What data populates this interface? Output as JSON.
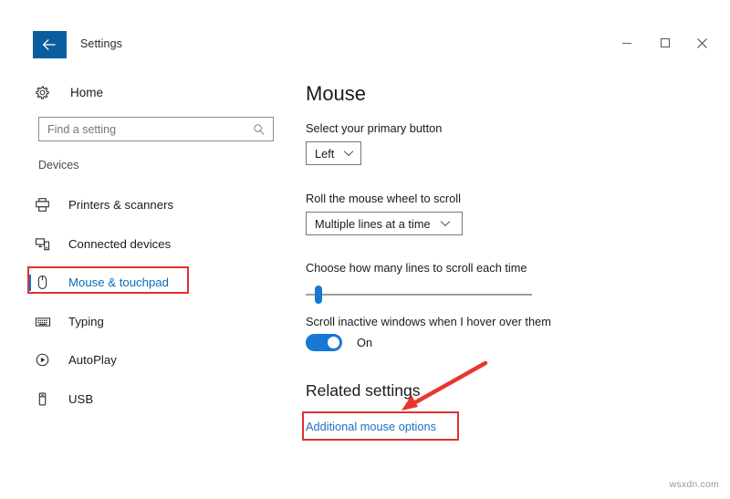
{
  "window": {
    "title": "Settings",
    "back_icon": "back-arrow-icon",
    "controls": {
      "minimize": "minimize-icon",
      "maximize": "maximize-icon",
      "close": "close-icon"
    }
  },
  "sidebar": {
    "home": {
      "label": "Home",
      "icon": "gear-icon"
    },
    "search": {
      "placeholder": "Find a setting",
      "value": "",
      "icon": "search-icon"
    },
    "group_header": "Devices",
    "items": [
      {
        "label": "Printers & scanners",
        "icon": "printer-icon",
        "selected": false
      },
      {
        "label": "Connected devices",
        "icon": "connected-devices-icon",
        "selected": false
      },
      {
        "label": "Mouse & touchpad",
        "icon": "mouse-icon",
        "selected": true
      },
      {
        "label": "Typing",
        "icon": "keyboard-icon",
        "selected": false
      },
      {
        "label": "AutoPlay",
        "icon": "autoplay-icon",
        "selected": false
      },
      {
        "label": "USB",
        "icon": "usb-icon",
        "selected": false
      }
    ]
  },
  "main": {
    "title": "Mouse",
    "primary_button": {
      "label": "Select your primary button",
      "value": "Left",
      "chevron": "chevron-down-icon"
    },
    "wheel_scroll": {
      "label": "Roll the mouse wheel to scroll",
      "value": "Multiple lines at a time",
      "chevron": "chevron-down-icon"
    },
    "lines_slider": {
      "label": "Choose how many lines to scroll each time",
      "position_percent": 4
    },
    "inactive_scroll": {
      "label": "Scroll inactive windows when I hover over them",
      "state": "On"
    },
    "related": {
      "title": "Related settings",
      "link": "Additional mouse options"
    }
  },
  "annotations": {
    "highlight_color": "#e03030",
    "arrow": "red-arrow-annotation"
  },
  "watermark": "wsxdn.com",
  "colors": {
    "accent": "#0078d7",
    "titlebar_back": "#0b5e9e",
    "link": "#1f6fc4",
    "selected_text": "#0b6cb5"
  }
}
